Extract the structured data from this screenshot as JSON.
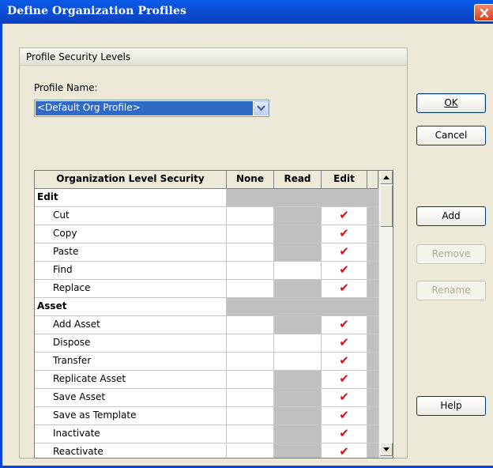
{
  "window": {
    "title": "Define Organization Profiles"
  },
  "group": {
    "title": "Profile Security Levels"
  },
  "profile": {
    "label": "Profile Name:",
    "selected": "<Default Org Profile>"
  },
  "grid": {
    "headers": [
      "Organization Level Security",
      "None",
      "Read",
      "Edit"
    ],
    "check_glyph": "✔",
    "check_color": "#d8121a",
    "rows": [
      {
        "label": "Edit",
        "type": "category"
      },
      {
        "label": "Cut",
        "type": "item",
        "read_available": false,
        "level": "Edit"
      },
      {
        "label": "Copy",
        "type": "item",
        "read_available": false,
        "level": "Edit"
      },
      {
        "label": "Paste",
        "type": "item",
        "read_available": false,
        "level": "Edit"
      },
      {
        "label": "Find",
        "type": "item",
        "read_available": true,
        "level": "Edit"
      },
      {
        "label": "Replace",
        "type": "item",
        "read_available": false,
        "level": "Edit"
      },
      {
        "label": "Asset",
        "type": "category"
      },
      {
        "label": "Add Asset",
        "type": "item",
        "read_available": false,
        "level": "Edit"
      },
      {
        "label": "Dispose",
        "type": "item",
        "read_available": true,
        "level": "Edit"
      },
      {
        "label": "Transfer",
        "type": "item",
        "read_available": true,
        "level": "Edit"
      },
      {
        "label": "Replicate Asset",
        "type": "item",
        "read_available": false,
        "level": "Edit"
      },
      {
        "label": "Save Asset",
        "type": "item",
        "read_available": false,
        "level": "Edit"
      },
      {
        "label": "Save as Template",
        "type": "item",
        "read_available": false,
        "level": "Edit"
      },
      {
        "label": "Inactivate",
        "type": "item",
        "read_available": false,
        "level": "Edit"
      },
      {
        "label": "Reactivate",
        "type": "item",
        "read_available": false,
        "level": "Edit"
      }
    ]
  },
  "buttons": {
    "ok": {
      "label": "OK",
      "enabled": true
    },
    "cancel": {
      "label": "Cancel",
      "enabled": true
    },
    "add": {
      "label": "Add",
      "enabled": true
    },
    "remove": {
      "label": "Remove",
      "enabled": false
    },
    "rename": {
      "label": "Rename",
      "enabled": false
    },
    "help": {
      "label": "Help",
      "enabled": true
    }
  },
  "colors": {
    "titlebar": "#0b4fd6",
    "selection": "#316ac5",
    "face": "#ece9d8"
  }
}
